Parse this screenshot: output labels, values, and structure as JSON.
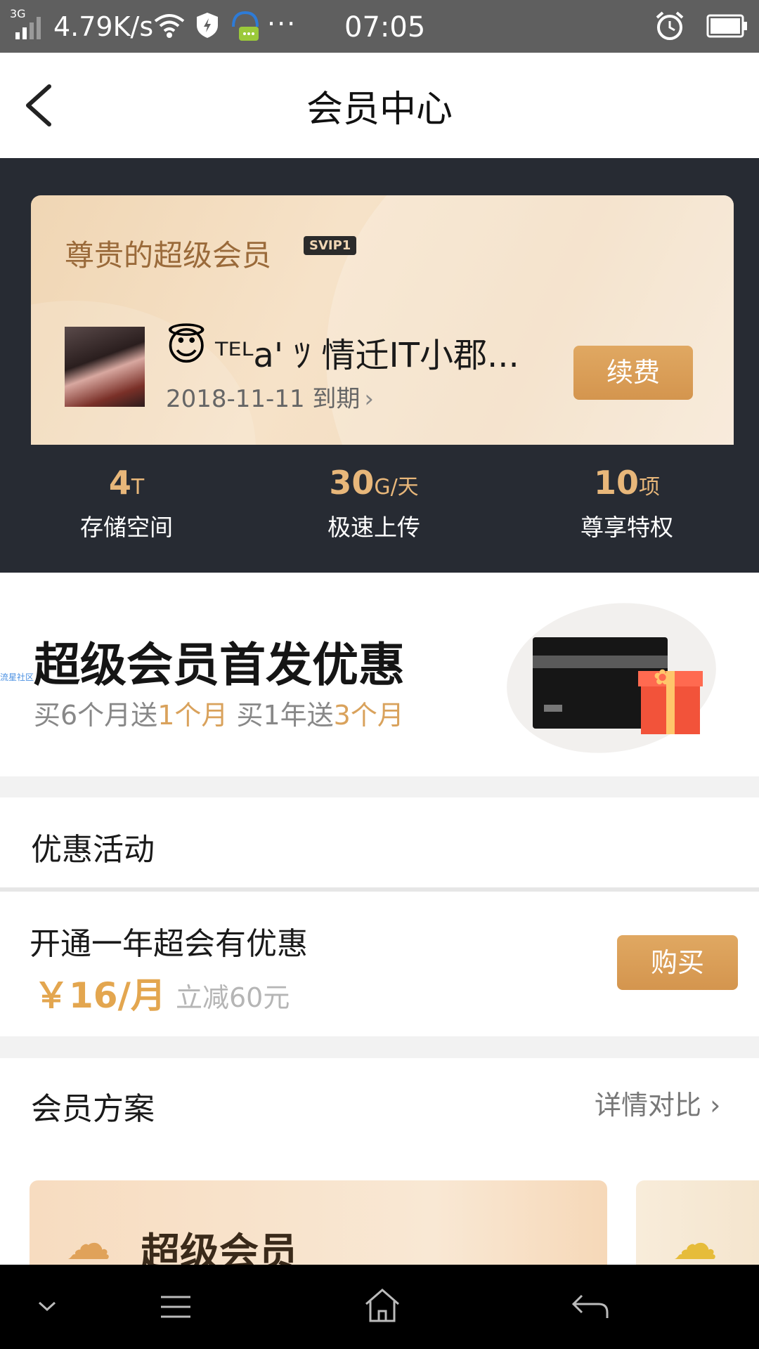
{
  "status_bar": {
    "network": "3G",
    "speed": "4.79K/s",
    "more": "···",
    "time": "07:05"
  },
  "nav": {
    "title": "会员中心"
  },
  "member_card": {
    "title": "尊贵的超级会员",
    "badge": "SVIP1",
    "username": "ᵀᴱᴸa' ﾂ 情迁IT小郡...",
    "expiry": "2018-11-11 到期",
    "renew_label": "续费"
  },
  "stats": [
    {
      "value": "4",
      "unit": "T",
      "label": "存储空间"
    },
    {
      "value": "30",
      "unit": "G/天",
      "label": "极速上传"
    },
    {
      "value": "10",
      "unit": "项",
      "label": "尊享特权"
    }
  ],
  "banner": {
    "title": "超级会员首发优惠",
    "sub_a": "买6个月送",
    "sub_b": "1个月",
    "sub_c": " 买1年送",
    "sub_d": "3个月",
    "watermark": "流星社区"
  },
  "promotions": {
    "heading": "优惠活动",
    "item_title": "开通一年超会有优惠",
    "price": "￥16/月",
    "discount": "立减60元",
    "buy_label": "购买"
  },
  "plans": {
    "heading": "会员方案",
    "compare_link": "详情对比",
    "card1_name": "超级会员"
  },
  "colors": {
    "accent": "#d9a25c",
    "dark_header": "#272b33",
    "status_bar": "#5f5f5f"
  }
}
